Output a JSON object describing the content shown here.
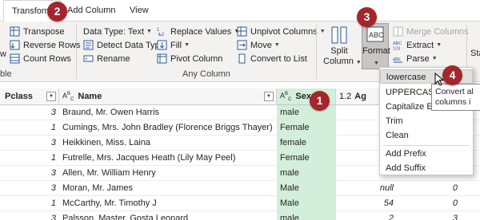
{
  "tabs": {
    "transform": "Transform",
    "add_column": "Add Column",
    "view": "View"
  },
  "ribbon": {
    "left_clipped_w": "w",
    "left_clipped_ble": "ble",
    "transpose": "Transpose",
    "reverse_rows": "Reverse Rows",
    "count_rows": "Count Rows",
    "data_type": "Data Type: Text",
    "detect_data_type": "Detect Data Type",
    "rename": "Rename",
    "replace_values": "Replace Values",
    "fill": "Fill",
    "pivot_column": "Pivot Column",
    "unpivot_columns": "Unpivot Columns",
    "move": "Move",
    "convert_to_list": "Convert to List",
    "any_column_group": "Any Column",
    "split_column_1": "Split",
    "split_column_2": "Column",
    "format": "Format",
    "merge_columns": "Merge Columns",
    "extract": "Extract",
    "parse": "Parse",
    "right_clipped": "Sta"
  },
  "grid": {
    "headers": {
      "pclass": "Pclass",
      "name": "Name",
      "sex": "Sex",
      "age": "Ag",
      "age_type": "1.2"
    },
    "rows": [
      {
        "pclass": "3",
        "name": "Braund, Mr. Owen Harris",
        "sex": "male",
        "age": "",
        "extra": ""
      },
      {
        "pclass": "1",
        "name": "Cumings, Mrs. John Bradley (Florence Briggs Thayer)",
        "sex": "Female",
        "age": "",
        "extra": ""
      },
      {
        "pclass": "3",
        "name": "Heikkinen, Miss. Laina",
        "sex": "female",
        "age": "",
        "extra": ""
      },
      {
        "pclass": "1",
        "name": "Futrelle, Mrs. Jacques Heath (Lily May Peel)",
        "sex": "Female",
        "age": "",
        "extra": ""
      },
      {
        "pclass": "3",
        "name": "Allen, Mr. William Henry",
        "sex": "male",
        "age": "",
        "extra": ""
      },
      {
        "pclass": "3",
        "name": "Moran, Mr. James",
        "sex": "Male",
        "age": "null",
        "extra": "0"
      },
      {
        "pclass": "1",
        "name": "McCarthy, Mr. Timothy J",
        "sex": "Male",
        "age": "54",
        "extra": "0"
      },
      {
        "pclass": "3",
        "name": "Palsson, Master. Gosta Leonard",
        "sex": "male",
        "age": "2",
        "extra": "3"
      }
    ]
  },
  "format_menu": {
    "items": [
      "lowercase",
      "UPPERCASE",
      "Capitalize Each Word",
      "Trim",
      "Clean"
    ],
    "items2": [
      "Add Prefix",
      "Add Suffix"
    ]
  },
  "tooltip": {
    "line1": "Convert al",
    "line2": "columns i"
  },
  "callouts": [
    "1",
    "2",
    "3",
    "4"
  ],
  "colors": {
    "callout": "#a4262c",
    "selected_column": "#d3eedb",
    "ribbon_bg": "#f3f2f1"
  }
}
